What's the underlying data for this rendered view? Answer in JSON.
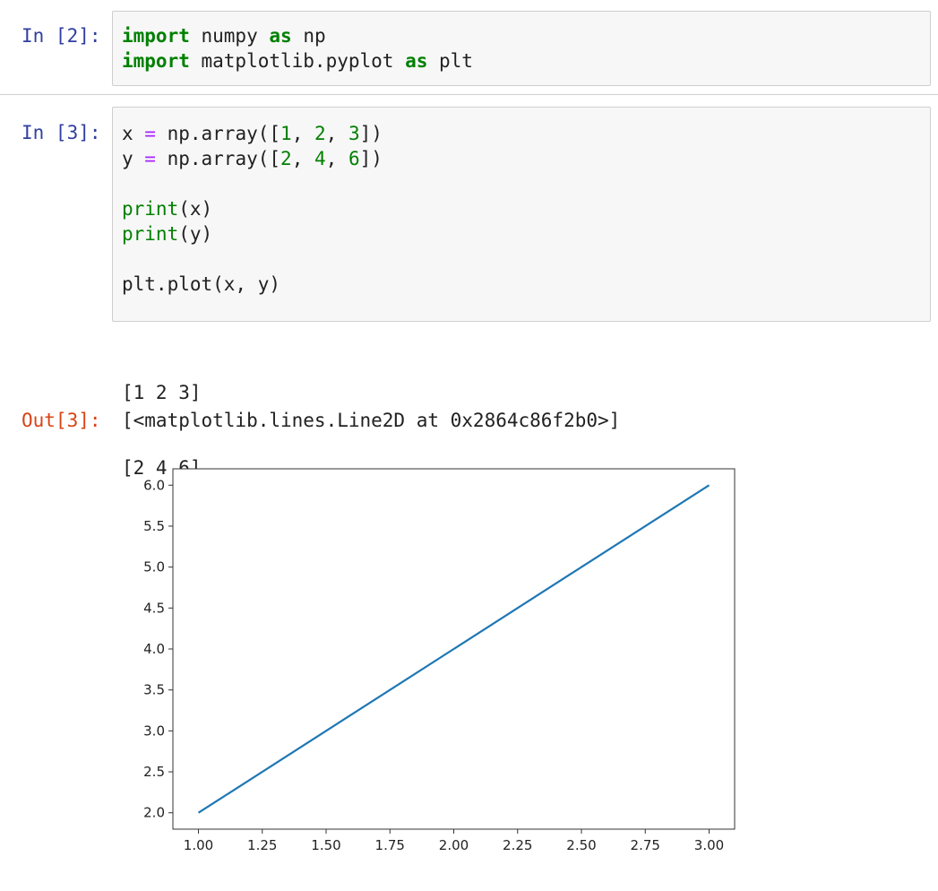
{
  "cells": [
    {
      "prompt": "In [2]:",
      "lines": [
        [
          {
            "t": "import",
            "c": "kw"
          },
          {
            "t": " numpy ",
            "c": ""
          },
          {
            "t": "as",
            "c": "kw"
          },
          {
            "t": " np",
            "c": ""
          }
        ],
        [
          {
            "t": "import",
            "c": "kw"
          },
          {
            "t": " matplotlib.pyplot ",
            "c": ""
          },
          {
            "t": "as",
            "c": "kw"
          },
          {
            "t": " plt",
            "c": ""
          }
        ]
      ]
    },
    {
      "prompt": "In [3]:",
      "lines": [
        [
          {
            "t": "x ",
            "c": ""
          },
          {
            "t": "=",
            "c": "op"
          },
          {
            "t": " np.array([",
            "c": ""
          },
          {
            "t": "1",
            "c": "num"
          },
          {
            "t": ", ",
            "c": ""
          },
          {
            "t": "2",
            "c": "num"
          },
          {
            "t": ", ",
            "c": ""
          },
          {
            "t": "3",
            "c": "num"
          },
          {
            "t": "])",
            "c": ""
          }
        ],
        [
          {
            "t": "y ",
            "c": ""
          },
          {
            "t": "=",
            "c": "op"
          },
          {
            "t": " np.array([",
            "c": ""
          },
          {
            "t": "2",
            "c": "num"
          },
          {
            "t": ", ",
            "c": ""
          },
          {
            "t": "4",
            "c": "num"
          },
          {
            "t": ", ",
            "c": ""
          },
          {
            "t": "6",
            "c": "num"
          },
          {
            "t": "])",
            "c": ""
          }
        ],
        [],
        [
          {
            "t": "print",
            "c": "builtin"
          },
          {
            "t": "(x)",
            "c": ""
          }
        ],
        [
          {
            "t": "print",
            "c": "builtin"
          },
          {
            "t": "(y)",
            "c": ""
          }
        ],
        [],
        [
          {
            "t": "plt.plot(x, y)",
            "c": ""
          }
        ]
      ],
      "stdout": [
        "[1 2 3]",
        "[2 4 6]"
      ],
      "out_prompt": "Out[3]:",
      "out_text": "[<matplotlib.lines.Line2D at 0x2864c86f2b0>]"
    }
  ],
  "chart_data": {
    "type": "line",
    "x": [
      1,
      2,
      3
    ],
    "series": [
      {
        "values": [
          2,
          4,
          6
        ],
        "color": "#1f77b4"
      }
    ],
    "xlim": [
      0.9,
      3.1
    ],
    "ylim": [
      1.8,
      6.2
    ],
    "xticks": [
      "1.00",
      "1.25",
      "1.50",
      "1.75",
      "2.00",
      "2.25",
      "2.50",
      "2.75",
      "3.00"
    ],
    "yticks": [
      "2.0",
      "2.5",
      "3.0",
      "3.5",
      "4.0",
      "4.5",
      "5.0",
      "5.5",
      "6.0"
    ],
    "title": "",
    "xlabel": "",
    "ylabel": "",
    "grid": false
  }
}
